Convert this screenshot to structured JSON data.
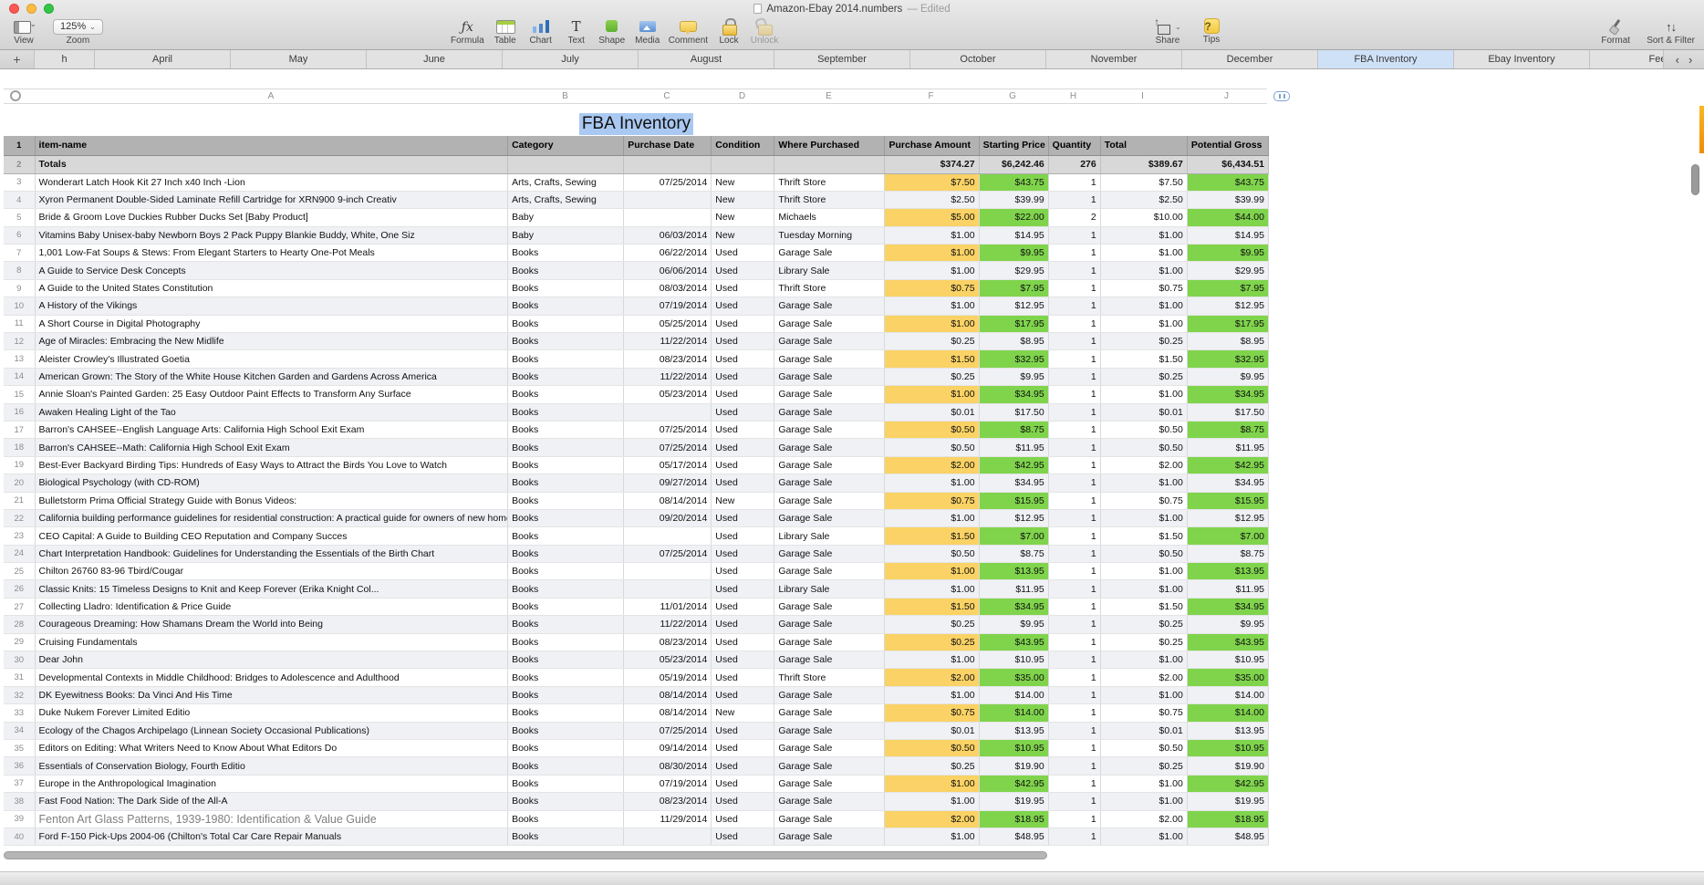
{
  "window": {
    "title": "Amazon-Ebay 2014.numbers",
    "edited_suffix": "— Edited"
  },
  "toolbar": {
    "view": {
      "label": "View"
    },
    "zoom": {
      "value": "125%",
      "label": "Zoom"
    },
    "tools": [
      {
        "id": "formula",
        "label": "Formula"
      },
      {
        "id": "table",
        "label": "Table"
      },
      {
        "id": "chart",
        "label": "Chart"
      },
      {
        "id": "text",
        "label": "Text"
      },
      {
        "id": "shape",
        "label": "Shape"
      },
      {
        "id": "media",
        "label": "Media"
      },
      {
        "id": "comment",
        "label": "Comment"
      },
      {
        "id": "lock",
        "label": "Lock"
      },
      {
        "id": "unlock",
        "label": "Unlock",
        "disabled": true
      }
    ],
    "share": {
      "label": "Share"
    },
    "tips": {
      "label": "Tips",
      "glyph": "?"
    },
    "format": {
      "label": "Format"
    },
    "sort_filter": {
      "label": "Sort & Filter"
    }
  },
  "tabbar": {
    "add_label": "+",
    "prev": "‹",
    "next": "›",
    "tabs": [
      {
        "label": "h",
        "partial": true
      },
      {
        "label": "April"
      },
      {
        "label": "May"
      },
      {
        "label": "June"
      },
      {
        "label": "July"
      },
      {
        "label": "August"
      },
      {
        "label": "September"
      },
      {
        "label": "October"
      },
      {
        "label": "November"
      },
      {
        "label": "December"
      },
      {
        "label": "FBA Inventory",
        "selected": true
      },
      {
        "label": "Ebay Inventory"
      },
      {
        "label": "Fee",
        "partial": true
      }
    ]
  },
  "ruler": {
    "letters": [
      "A",
      "B",
      "C",
      "D",
      "E",
      "F",
      "G",
      "H",
      "I",
      "J"
    ]
  },
  "sheet": {
    "table_title": "FBA Inventory",
    "header_row_number": 1,
    "totals_row_number": 2,
    "columns": [
      {
        "label": "item-name"
      },
      {
        "label": "Category"
      },
      {
        "label": "Purchase Date"
      },
      {
        "label": "Condition"
      },
      {
        "label": "Where Purchased"
      },
      {
        "label": "Purchase Amount"
      },
      {
        "label": "Starting Price"
      },
      {
        "label": "Quantity"
      },
      {
        "label": "Total"
      },
      {
        "label": "Potential Gross"
      }
    ],
    "totals": [
      "Totals",
      "",
      "",
      "",
      "",
      "$374.27",
      "$6,242.46",
      "276",
      "$389.67",
      "$6,434.51"
    ],
    "rows": [
      {
        "n": 3,
        "cells": [
          "Wonderart Latch Hook Kit 27 Inch x40 Inch -Lion",
          "Arts, Crafts, Sewing",
          "07/25/2014",
          "New",
          "Thrift Store",
          "$7.50",
          "$43.75",
          "1",
          "$7.50",
          "$43.75"
        ]
      },
      {
        "n": 4,
        "cells": [
          "Xyron Permanent Double-Sided Laminate Refill Cartridge for XRN900 9-inch Creativ",
          "Arts, Crafts, Sewing",
          "",
          "New",
          "Thrift Store",
          "$2.50",
          "$39.99",
          "1",
          "$2.50",
          "$39.99"
        ]
      },
      {
        "n": 5,
        "cells": [
          "Bride & Groom Love Duckies Rubber Ducks Set [Baby Product]",
          "Baby",
          "",
          "New",
          "Michaels",
          "$5.00",
          "$22.00",
          "2",
          "$10.00",
          "$44.00"
        ]
      },
      {
        "n": 6,
        "cells": [
          "Vitamins Baby Unisex-baby Newborn Boys 2 Pack Puppy Blankie Buddy, White, One Siz",
          "Baby",
          "06/03/2014",
          "New",
          "Tuesday Morning",
          "$1.00",
          "$14.95",
          "1",
          "$1.00",
          "$14.95"
        ]
      },
      {
        "n": 7,
        "cells": [
          "1,001 Low-Fat Soups & Stews: From Elegant Starters to Hearty One-Pot Meals",
          "Books",
          "06/22/2014",
          "Used",
          "Garage Sale",
          "$1.00",
          "$9.95",
          "1",
          "$1.00",
          "$9.95"
        ]
      },
      {
        "n": 8,
        "cells": [
          "A Guide to Service Desk Concepts",
          "Books",
          "06/06/2014",
          "Used",
          "Library Sale",
          "$1.00",
          "$29.95",
          "1",
          "$1.00",
          "$29.95"
        ]
      },
      {
        "n": 9,
        "cells": [
          "A Guide to the United States Constitution",
          "Books",
          "08/03/2014",
          "Used",
          "Thrift Store",
          "$0.75",
          "$7.95",
          "1",
          "$0.75",
          "$7.95"
        ]
      },
      {
        "n": 10,
        "cells": [
          "A History of the Vikings",
          "Books",
          "07/19/2014",
          "Used",
          "Garage Sale",
          "$1.00",
          "$12.95",
          "1",
          "$1.00",
          "$12.95"
        ]
      },
      {
        "n": 11,
        "cells": [
          "A Short Course in Digital Photography",
          "Books",
          "05/25/2014",
          "Used",
          "Garage Sale",
          "$1.00",
          "$17.95",
          "1",
          "$1.00",
          "$17.95"
        ]
      },
      {
        "n": 12,
        "cells": [
          "Age of Miracles: Embracing the New Midlife",
          "Books",
          "11/22/2014",
          "Used",
          "Garage Sale",
          "$0.25",
          "$8.95",
          "1",
          "$0.25",
          "$8.95"
        ]
      },
      {
        "n": 13,
        "cells": [
          "Aleister Crowley's Illustrated Goetia",
          "Books",
          "08/23/2014",
          "Used",
          "Garage Sale",
          "$1.50",
          "$32.95",
          "1",
          "$1.50",
          "$32.95"
        ]
      },
      {
        "n": 14,
        "cells": [
          "American Grown: The Story of the White House Kitchen Garden and Gardens Across America",
          "Books",
          "11/22/2014",
          "Used",
          "Garage Sale",
          "$0.25",
          "$9.95",
          "1",
          "$0.25",
          "$9.95"
        ]
      },
      {
        "n": 15,
        "cells": [
          "Annie Sloan's Painted Garden: 25 Easy Outdoor Paint Effects to Transform Any Surface",
          "Books",
          "05/23/2014",
          "Used",
          "Garage Sale",
          "$1.00",
          "$34.95",
          "1",
          "$1.00",
          "$34.95"
        ]
      },
      {
        "n": 16,
        "cells": [
          "Awaken Healing Light of the Tao",
          "Books",
          "",
          "Used",
          "Garage Sale",
          "$0.01",
          "$17.50",
          "1",
          "$0.01",
          "$17.50"
        ]
      },
      {
        "n": 17,
        "cells": [
          "Barron's CAHSEE--English Language Arts: California High School Exit Exam",
          "Books",
          "07/25/2014",
          "Used",
          "Garage Sale",
          "$0.50",
          "$8.75",
          "1",
          "$0.50",
          "$8.75"
        ]
      },
      {
        "n": 18,
        "cells": [
          "Barron's CAHSEE--Math: California High School Exit Exam",
          "Books",
          "07/25/2014",
          "Used",
          "Garage Sale",
          "$0.50",
          "$11.95",
          "1",
          "$0.50",
          "$11.95"
        ]
      },
      {
        "n": 19,
        "cells": [
          "Best-Ever Backyard Birding Tips: Hundreds of Easy Ways to Attract the Birds You Love to Watch",
          "Books",
          "05/17/2014",
          "Used",
          "Garage Sale",
          "$2.00",
          "$42.95",
          "1",
          "$2.00",
          "$42.95"
        ]
      },
      {
        "n": 20,
        "cells": [
          "Biological Psychology (with CD-ROM)",
          "Books",
          "09/27/2014",
          "Used",
          "Garage Sale",
          "$1.00",
          "$34.95",
          "1",
          "$1.00",
          "$34.95"
        ]
      },
      {
        "n": 21,
        "cells": [
          "Bulletstorm Prima Official Strategy Guide with Bonus Videos:",
          "Books",
          "08/14/2014",
          "New",
          "Garage Sale",
          "$0.75",
          "$15.95",
          "1",
          "$0.75",
          "$15.95"
        ]
      },
      {
        "n": 22,
        "cells": [
          "California building performance guidelines for residential construction: A practical guide for owners of new homes : constr",
          "Books",
          "09/20/2014",
          "Used",
          "Garage Sale",
          "$1.00",
          "$12.95",
          "1",
          "$1.00",
          "$12.95"
        ]
      },
      {
        "n": 23,
        "cells": [
          "CEO Capital: A Guide to Building CEO Reputation and Company Succes",
          "Books",
          "",
          "Used",
          "Library Sale",
          "$1.50",
          "$7.00",
          "1",
          "$1.50",
          "$7.00"
        ]
      },
      {
        "n": 24,
        "cells": [
          "Chart Interpretation Handbook: Guidelines for Understanding the Essentials of the Birth Chart",
          "Books",
          "07/25/2014",
          "Used",
          "Garage Sale",
          "$0.50",
          "$8.75",
          "1",
          "$0.50",
          "$8.75"
        ]
      },
      {
        "n": 25,
        "cells": [
          "Chilton 26760 83-96 Tbird/Cougar",
          "Books",
          "",
          "Used",
          "Garage Sale",
          "$1.00",
          "$13.95",
          "1",
          "$1.00",
          "$13.95"
        ]
      },
      {
        "n": 26,
        "cells": [
          "Classic Knits: 15 Timeless Designs to Knit and Keep Forever (Erika Knight Col...",
          "Books",
          "",
          "Used",
          "Library Sale",
          "$1.00",
          "$11.95",
          "1",
          "$1.00",
          "$11.95"
        ]
      },
      {
        "n": 27,
        "cells": [
          "Collecting Lladro: Identification & Price Guide",
          "Books",
          "11/01/2014",
          "Used",
          "Garage Sale",
          "$1.50",
          "$34.95",
          "1",
          "$1.50",
          "$34.95"
        ]
      },
      {
        "n": 28,
        "cells": [
          "Courageous Dreaming: How Shamans Dream the World into Being",
          "Books",
          "11/22/2014",
          "Used",
          "Garage Sale",
          "$0.25",
          "$9.95",
          "1",
          "$0.25",
          "$9.95"
        ]
      },
      {
        "n": 29,
        "cells": [
          "Cruising Fundamentals",
          "Books",
          "08/23/2014",
          "Used",
          "Garage Sale",
          "$0.25",
          "$43.95",
          "1",
          "$0.25",
          "$43.95"
        ]
      },
      {
        "n": 30,
        "cells": [
          "Dear John",
          "Books",
          "05/23/2014",
          "Used",
          "Garage Sale",
          "$1.00",
          "$10.95",
          "1",
          "$1.00",
          "$10.95"
        ]
      },
      {
        "n": 31,
        "cells": [
          "Developmental Contexts in Middle Childhood: Bridges to Adolescence and Adulthood",
          "Books",
          "05/19/2014",
          "Used",
          "Thrift Store",
          "$2.00",
          "$35.00",
          "1",
          "$2.00",
          "$35.00"
        ]
      },
      {
        "n": 32,
        "cells": [
          "DK Eyewitness Books: Da Vinci And His Time",
          "Books",
          "08/14/2014",
          "Used",
          "Garage Sale",
          "$1.00",
          "$14.00",
          "1",
          "$1.00",
          "$14.00"
        ]
      },
      {
        "n": 33,
        "cells": [
          "Duke Nukem Forever Limited Editio",
          "Books",
          "08/14/2014",
          "New",
          "Garage Sale",
          "$0.75",
          "$14.00",
          "1",
          "$0.75",
          "$14.00"
        ]
      },
      {
        "n": 34,
        "cells": [
          "Ecology of the Chagos Archipelago (Linnean Society Occasional Publications)",
          "Books",
          "07/25/2014",
          "Used",
          "Garage Sale",
          "$0.01",
          "$13.95",
          "1",
          "$0.01",
          "$13.95"
        ]
      },
      {
        "n": 35,
        "cells": [
          "Editors on Editing: What Writers Need to Know About What Editors Do",
          "Books",
          "09/14/2014",
          "Used",
          "Garage Sale",
          "$0.50",
          "$10.95",
          "1",
          "$0.50",
          "$10.95"
        ]
      },
      {
        "n": 36,
        "cells": [
          "Essentials of Conservation Biology, Fourth Editio",
          "Books",
          "08/30/2014",
          "Used",
          "Garage Sale",
          "$0.25",
          "$19.90",
          "1",
          "$0.25",
          "$19.90"
        ]
      },
      {
        "n": 37,
        "cells": [
          "Europe in the Anthropological Imagination",
          "Books",
          "07/19/2014",
          "Used",
          "Garage Sale",
          "$1.00",
          "$42.95",
          "1",
          "$1.00",
          "$42.95"
        ]
      },
      {
        "n": 38,
        "cells": [
          "Fast Food Nation: The Dark Side of the All-A",
          "Books",
          "08/23/2014",
          "Used",
          "Garage Sale",
          "$1.00",
          "$19.95",
          "1",
          "$1.00",
          "$19.95"
        ]
      },
      {
        "n": 39,
        "muted": true,
        "cells": [
          "Fenton Art Glass Patterns, 1939-1980: Identification & Value Guide",
          "Books",
          "11/29/2014",
          "Used",
          "Garage Sale",
          "$2.00",
          "$18.95",
          "1",
          "$2.00",
          "$18.95"
        ]
      },
      {
        "n": 40,
        "cells": [
          "Ford F-150 Pick-Ups 2004-06 (Chilton's Total Car Care Repair Manuals",
          "Books",
          "",
          "Used",
          "Garage Sale",
          "$1.00",
          "$48.95",
          "1",
          "$1.00",
          "$48.95"
        ]
      }
    ]
  },
  "colors": {
    "purchase_amount_bg": "#fad265",
    "price_green_bg": "#7fd44c",
    "selected_tab_bg": "#cfe1f7",
    "title_selection_bg": "#aac9f2"
  }
}
